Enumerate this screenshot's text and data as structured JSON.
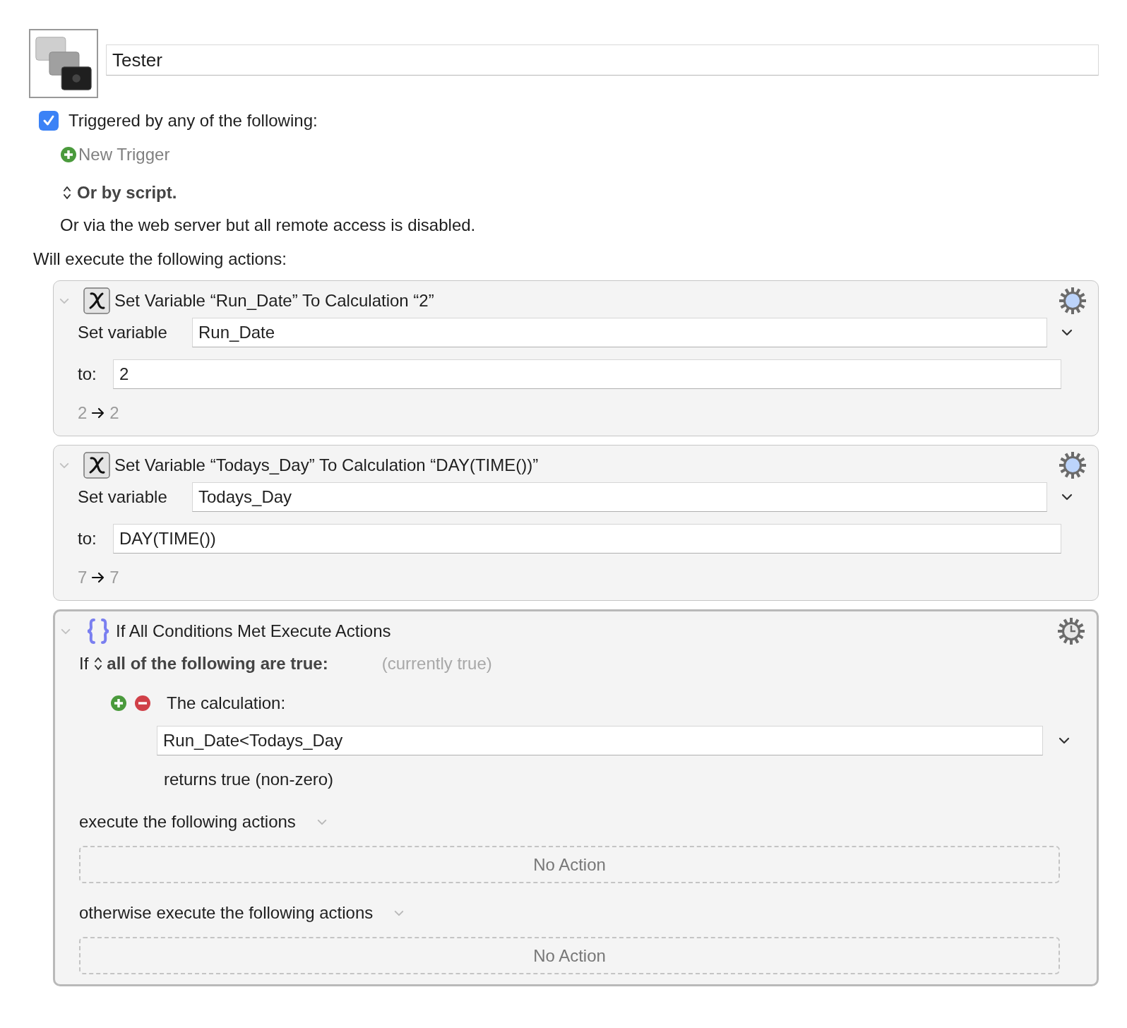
{
  "macro": {
    "name": "Tester"
  },
  "trigger": {
    "checked": true,
    "label": "Triggered by any of the following:",
    "new_trigger": "New Trigger",
    "script_option": "Or by script.",
    "web_server_note": "Or via the web server but all remote access is disabled."
  },
  "actions_heading": "Will execute the following actions:",
  "actions": [
    {
      "kind": "set_variable",
      "expanded": true,
      "selected": false,
      "title": "Set Variable “Run_Date” To Calculation “2”",
      "variable_label": "Set variable",
      "variable": "Run_Date",
      "to_label": "to:",
      "value": "2",
      "preview_from": "2",
      "preview_to": "2"
    },
    {
      "kind": "set_variable",
      "expanded": true,
      "selected": false,
      "title": "Set Variable “Todays_Day” To Calculation “DAY(TIME())”",
      "variable_label": "Set variable",
      "variable": "Todays_Day",
      "to_label": "to:",
      "value": "DAY(TIME())",
      "preview_from": "7",
      "preview_to": "7"
    },
    {
      "kind": "if",
      "expanded": true,
      "selected": true,
      "title": "If All Conditions Met Execute Actions",
      "if_label": "If",
      "condition_mode": "all of the following are true:",
      "status": "(currently true)",
      "conditions": [
        {
          "label": "The calculation:",
          "value": "Run_Date<Todays_Day",
          "result": "returns true (non-zero)"
        }
      ],
      "branches": [
        {
          "label": "execute the following actions",
          "empty": "No Action"
        },
        {
          "label": "otherwise execute the following actions",
          "empty": "No Action"
        }
      ]
    }
  ]
}
